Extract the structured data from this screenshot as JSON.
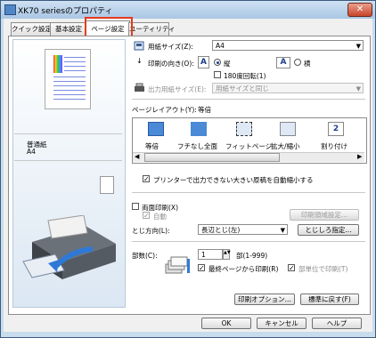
{
  "window": {
    "title": "XK70 seriesのプロパティ",
    "close": "✕"
  },
  "tabs": [
    "クイック設定",
    "基本設定",
    "ページ設定",
    "ユーティリティ"
  ],
  "preview": {
    "media": "普通紙",
    "size": "A4"
  },
  "page_size": {
    "label": "用紙サイズ(Z):",
    "value": "A4"
  },
  "orientation": {
    "label": "印刷の向き(O):",
    "portrait": "縦",
    "landscape": "横",
    "selected": "portrait",
    "rotate_label": "180度回転(1)"
  },
  "output_size": {
    "label": "出力用紙サイズ(E):",
    "value": "用紙サイズと同じ"
  },
  "page_layout": {
    "label": "ページレイアウト(Y):",
    "value": "等倍",
    "items": [
      "等倍",
      "フチなし全面",
      "フィットページ",
      "拡大/縮小",
      "割り付け"
    ]
  },
  "auto_reduce": {
    "label": "プリンターで出力できない大きい原稿を自動縮小する",
    "checked": true
  },
  "duplex": {
    "label": "両面印刷(X)",
    "auto": "自動",
    "settings_button": "印刷領域設定..."
  },
  "binding": {
    "label": "とじ方向(L):",
    "value": "長辺とじ(左)",
    "margin_button": "とじしろ指定..."
  },
  "copies": {
    "label": "部数(C):",
    "value": "1",
    "range": "部(1-999)",
    "last_page_first": "最終ページから印刷(R)",
    "collate": "部単位で印刷(T)"
  },
  "buttons": {
    "print_options": "印刷オプション...",
    "defaults": "標準に戻す(F)",
    "ok": "OK",
    "cancel": "キャンセル",
    "help": "ヘルプ"
  },
  "icons": {
    "paper": "paper-icon",
    "orientation": "orientation-arrow-icon",
    "output": "printer-icon",
    "copies": "copies-stack-icon"
  }
}
